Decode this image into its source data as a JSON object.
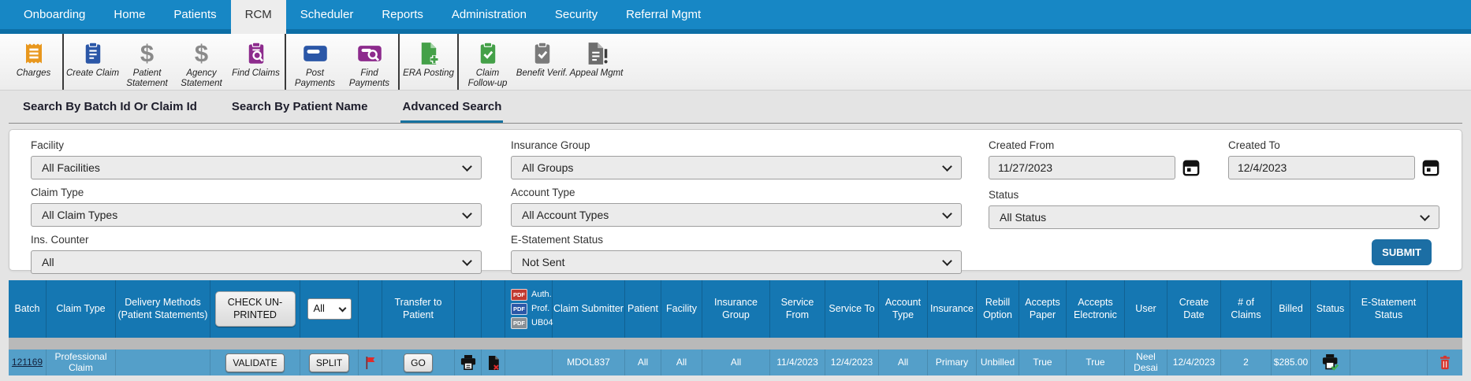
{
  "nav": {
    "items": [
      {
        "label": "Onboarding",
        "active": false
      },
      {
        "label": "Home",
        "active": false
      },
      {
        "label": "Patients",
        "active": false
      },
      {
        "label": "RCM",
        "active": true
      },
      {
        "label": "Scheduler",
        "active": false
      },
      {
        "label": "Reports",
        "active": false
      },
      {
        "label": "Administration",
        "active": false
      },
      {
        "label": "Security",
        "active": false
      },
      {
        "label": "Referral Mgmt",
        "active": false
      }
    ]
  },
  "toolbar": {
    "items": [
      {
        "label": "Charges",
        "icon": "receipt-icon",
        "color": "#e8971d"
      },
      {
        "label": "Create Claim",
        "icon": "clipboard-lines-icon",
        "color": "#2b57a7"
      },
      {
        "label": "Patient Statement",
        "icon": "dollar-icon",
        "color": "#8a8a8a"
      },
      {
        "label": "Agency Statement",
        "icon": "dollar-icon",
        "color": "#8a8a8a"
      },
      {
        "label": "Find Claims",
        "icon": "clipboard-search-icon",
        "color": "#8d2b8d"
      },
      {
        "label": "Post Payments",
        "icon": "credit-card-icon",
        "color": "#2b57a7"
      },
      {
        "label": "Find Payments",
        "icon": "card-search-icon",
        "color": "#8d2b8d"
      },
      {
        "label": "ERA Posting",
        "icon": "file-plus-icon",
        "color": "#44a048"
      },
      {
        "label": "Claim Follow-up",
        "icon": "clipboard-check-icon",
        "color": "#44a048"
      },
      {
        "label": "Benefit Verif.",
        "icon": "clipboard-check-icon",
        "color": "#7a7a7a"
      },
      {
        "label": "Appeal Mgmt",
        "icon": "file-alert-icon",
        "color": "#6d6d6d"
      }
    ]
  },
  "search_tabs": {
    "items": [
      {
        "label": "Search By Batch Id Or Claim Id",
        "active": false
      },
      {
        "label": "Search By Patient Name",
        "active": false
      },
      {
        "label": "Advanced Search",
        "active": true
      }
    ]
  },
  "filters": {
    "facility": {
      "label": "Facility",
      "value": "All Facilities"
    },
    "insurance_group": {
      "label": "Insurance Group",
      "value": "All Groups"
    },
    "created_from": {
      "label": "Created From",
      "value": "11/27/2023",
      "icon": "calendar-icon"
    },
    "created_to": {
      "label": "Created To",
      "value": "12/4/2023",
      "icon": "calendar-icon"
    },
    "claim_type": {
      "label": "Claim Type",
      "value": "All Claim Types"
    },
    "account_type": {
      "label": "Account Type",
      "value": "All Account Types"
    },
    "status": {
      "label": "Status",
      "value": "All Status"
    },
    "ins_counter": {
      "label": "Ins. Counter",
      "value": "All"
    },
    "estatement_status": {
      "label": "E-Statement Status",
      "value": "Not Sent"
    },
    "submit_label": "SUBMIT"
  },
  "table": {
    "header": {
      "batch": "Batch",
      "claim_type": "Claim Type",
      "delivery_methods": "Delivery Methods (Patient Statements)",
      "check_unprinted": "CHECK UN-PRINTED",
      "filter_all": "All",
      "transfer_to_patient": "Transfer to Patient",
      "pdf_badge": "PDF",
      "pdf_auth": "Auth.",
      "pdf_prof": "Prof.",
      "pdf_ub04": "UB04",
      "claim_submitter": "Claim Submitter",
      "patient": "Patient",
      "facility": "Facility",
      "insurance_group": "Insurance Group",
      "service_from": "Service From",
      "service_to": "Service To",
      "account_type": "Account Type",
      "insurance": "Insurance",
      "rebill_option": "Rebill Option",
      "accepts_paper": "Accepts Paper",
      "accepts_electronic": "Accepts Electronic",
      "user": "User",
      "create_date": "Create Date",
      "num_claims": "# of Claims",
      "billed": "Billed",
      "status": "Status",
      "estatement_status": "E-Statement Status"
    },
    "row": {
      "batch": "121169",
      "claim_type": "Professional Claim",
      "validate": "VALIDATE",
      "split": "SPLIT",
      "go": "GO",
      "flag_icon": "flag-icon",
      "print_icon": "printer-icon",
      "remove_doc_icon": "document-remove-icon",
      "claim_submitter": "MDOL837",
      "patient": "All",
      "facility": "All",
      "insurance_group": "All",
      "service_from": "11/4/2023",
      "service_to": "12/4/2023",
      "account_type": "All",
      "insurance": "Primary",
      "rebill_option": "Unbilled",
      "accepts_paper": "True",
      "accepts_electronic": "True",
      "user": "Neel Desai",
      "create_date": "12/4/2023",
      "num_claims": "2",
      "billed": "$285.00",
      "status_icon": "printer-success-icon",
      "estatement_status": "",
      "delete_icon": "trash-icon"
    }
  },
  "colors": {
    "nav_blue": "#1787c5",
    "nav_bottom_blue": "#0d6fa6",
    "table_header_blue": "#1577b2",
    "row_blue": "#549fc9",
    "submit_blue": "#1c6ea4",
    "active_tab_underline": "#16729f",
    "flag_red": "#e02b2b",
    "trash_red": "#d9342b"
  }
}
